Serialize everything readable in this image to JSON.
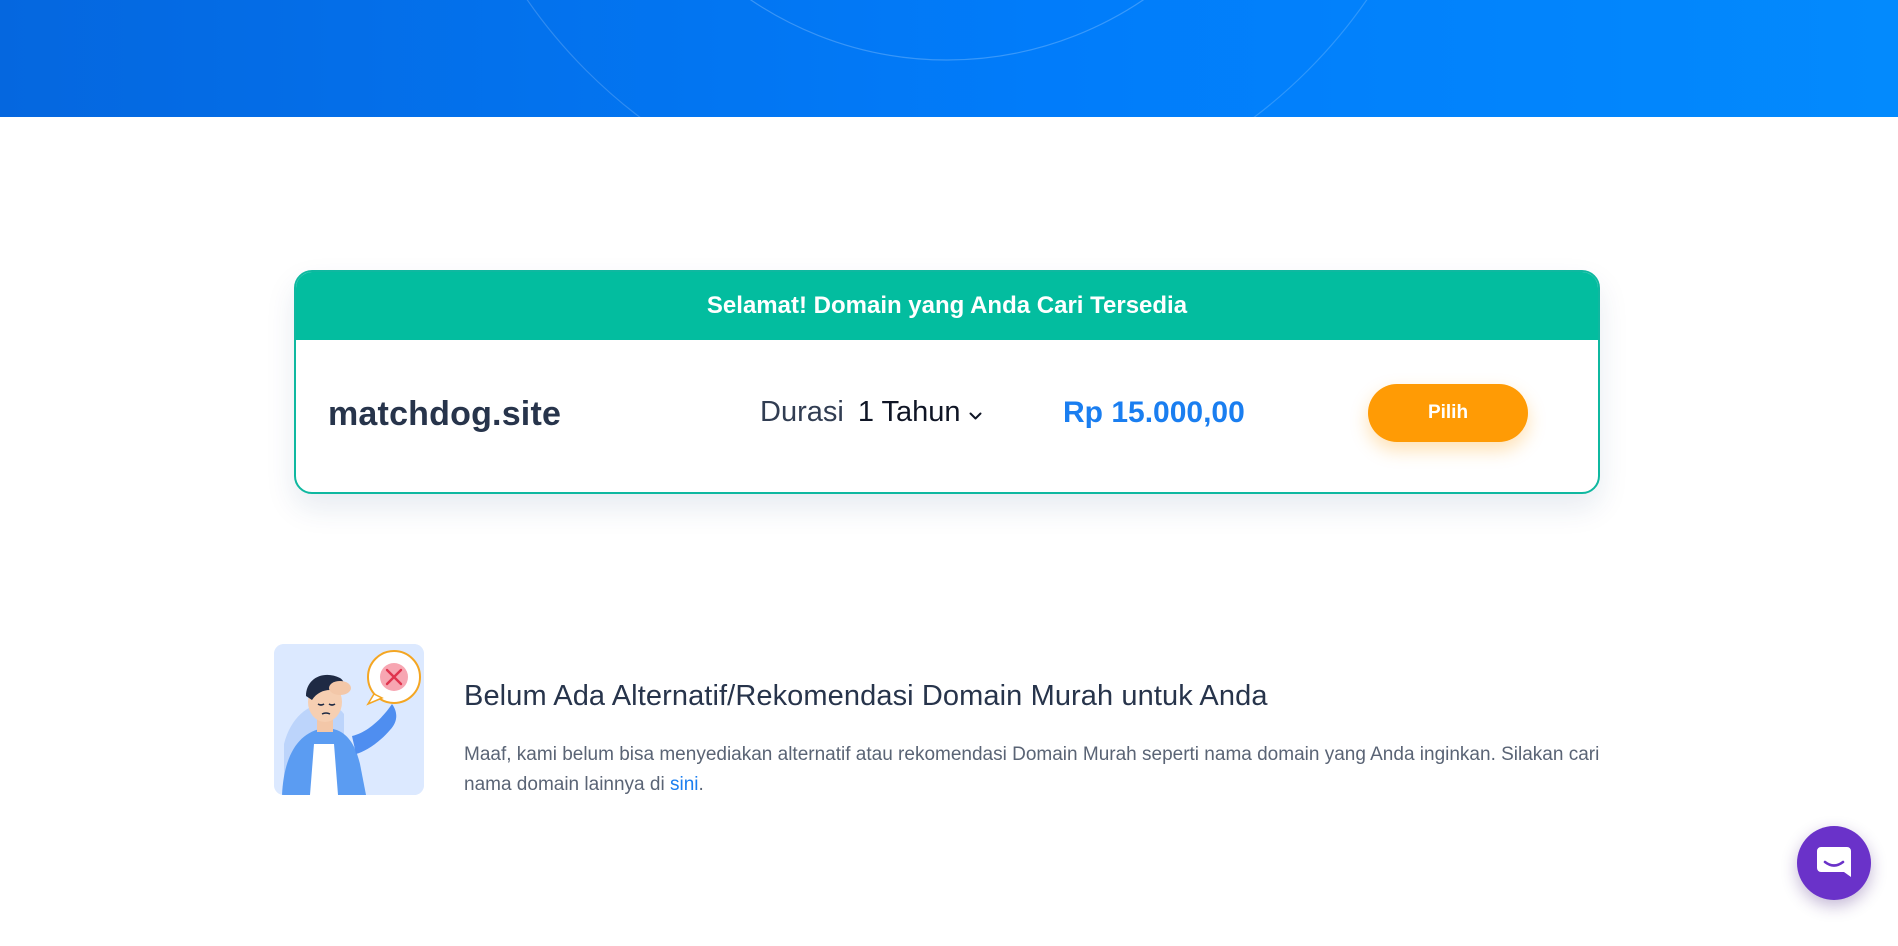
{
  "availability": {
    "header": "Selamat! Domain yang Anda Cari Tersedia",
    "domain": "matchdog.site",
    "duration_label": "Durasi",
    "duration_value": "1 Tahun",
    "price": "Rp 15.000,00",
    "select_button": "Pilih"
  },
  "no_alternative": {
    "title": "Belum Ada Alternatif/Rekomendasi Domain Murah untuk Anda",
    "description": "Maaf, kami belum bisa menyediakan alternatif atau rekomendasi Domain Murah seperti nama domain yang Anda inginkan. Silakan cari nama domain lainnya di ",
    "link_text": "sini",
    "description_end": "."
  },
  "colors": {
    "hero_start": "#0567df",
    "hero_end": "#038afd",
    "success_header": "#03bd9f",
    "price_blue": "#1a7ef0",
    "button_orange": "#ff9b05",
    "chat_purple": "#6a32c9"
  },
  "icons": {
    "duration_select": "chevron-down-icon",
    "illustration": "confused-person-illustration",
    "error_badge": "x-circle-icon",
    "chat": "chat-bubble-icon"
  }
}
